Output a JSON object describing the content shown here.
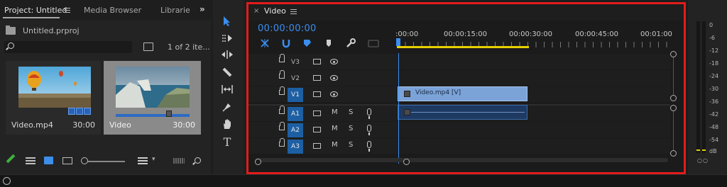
{
  "project_panel": {
    "tabs": [
      {
        "label": "Project: Untitled",
        "active": true
      },
      {
        "label": "Media Browser",
        "active": false
      },
      {
        "label": "Librarie",
        "active": false
      }
    ],
    "overflow_label": "»",
    "project_file": "Untitled.prproj",
    "search": {
      "value": "",
      "placeholder": ""
    },
    "item_count": "1 of 2 ite...",
    "clips": [
      {
        "name": "Video.mp4",
        "duration": "30:00",
        "selected": false,
        "thumbnail": "hot-air-balloon"
      },
      {
        "name": "Video",
        "duration": "30:00",
        "selected": true,
        "thumbnail": "coastal-cliffs"
      }
    ],
    "bottom_icons": [
      "pencil-icon",
      "list-view-icon",
      "icon-view-icon",
      "freeform-view-icon",
      "zoom-slider",
      "sort-icon",
      "automate-icon",
      "find-icon"
    ]
  },
  "tools": [
    "selection-tool",
    "track-select-tool",
    "ripple-edit-tool",
    "razor-tool",
    "slip-tool",
    "pen-tool",
    "hand-tool",
    "type-tool"
  ],
  "timeline": {
    "title": "Video",
    "close_label": "×",
    "timecode": "00:00:00:00",
    "ruler_labels": [
      ":00:00",
      "00:00:15:00",
      "00:00:30:00",
      "00:00:45:00",
      "00:01:00"
    ],
    "video_tracks": [
      {
        "label": "V3",
        "targeted": false
      },
      {
        "label": "V2",
        "targeted": false
      },
      {
        "label": "V1",
        "targeted": true
      }
    ],
    "audio_tracks": [
      {
        "label": "A1",
        "targeted": true,
        "mute": "M",
        "solo": "S"
      },
      {
        "label": "A2",
        "targeted": true,
        "mute": "M",
        "solo": "S"
      },
      {
        "label": "A3",
        "targeted": true,
        "mute": "M",
        "solo": "S"
      }
    ],
    "video_clip": {
      "label": "Video.mp4 [V]",
      "fx": "fx"
    },
    "audio_clip": {
      "fx": "fx"
    },
    "work_area_color": "#e8d000",
    "playhead_color": "#3b8ef0",
    "highlight_frame_color": "#e21b1b"
  },
  "audio_meter": {
    "scale": [
      "0",
      "-6",
      "-12",
      "-18",
      "-24",
      "-30",
      "-36",
      "-42",
      "-48",
      "-54",
      "dB"
    ],
    "solo_label": "○○"
  }
}
